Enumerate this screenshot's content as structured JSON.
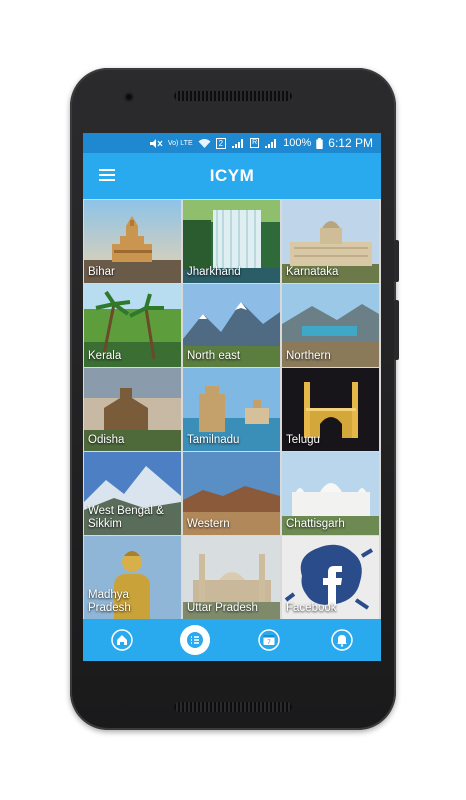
{
  "app": {
    "title": "ICYM"
  },
  "status_bar": {
    "time": "6:12 PM",
    "battery": "100%",
    "network": "Vo) LTE",
    "sim": "2",
    "roaming": "R"
  },
  "tiles": [
    {
      "label": "Bihar",
      "icon": "temple"
    },
    {
      "label": "Jharkhand",
      "icon": "waterfall"
    },
    {
      "label": "Karnataka",
      "icon": "palace"
    },
    {
      "label": "Kerala",
      "icon": "palm-trees"
    },
    {
      "label": "North east",
      "icon": "mountains"
    },
    {
      "label": "Northern",
      "icon": "lake"
    },
    {
      "label": "Odisha",
      "icon": "sun-temple"
    },
    {
      "label": "Tamilnadu",
      "icon": "gopuram"
    },
    {
      "label": "Telugu",
      "icon": "charminar"
    },
    {
      "label": "West Bengal &\nSikkim",
      "icon": "snow-peaks"
    },
    {
      "label": "Western",
      "icon": "desert-hills"
    },
    {
      "label": "Chattisgarh",
      "icon": "gurudwara"
    },
    {
      "label": "Madhya\nPradesh",
      "icon": "buddha"
    },
    {
      "label": "Uttar Pradesh",
      "icon": "mosque"
    },
    {
      "label": "Facebook",
      "icon": "facebook"
    }
  ],
  "bottom_nav": [
    {
      "name": "home",
      "icon": "home-icon",
      "active": false
    },
    {
      "name": "list",
      "icon": "list-icon",
      "active": true
    },
    {
      "name": "calendar",
      "icon": "calendar-icon",
      "badge": "7",
      "active": false
    },
    {
      "name": "notifications",
      "icon": "bell-icon",
      "active": false
    }
  ],
  "colors": {
    "primary": "#29a9ee",
    "status_bar": "#1e88d1",
    "label_text": "#ffffff"
  }
}
